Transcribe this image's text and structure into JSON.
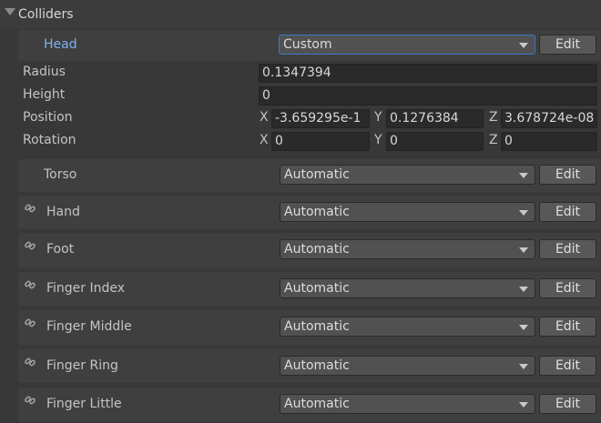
{
  "section": {
    "title": "Colliders"
  },
  "head": {
    "label": "Head",
    "dropdown": "Custom",
    "edit": "Edit",
    "radius_label": "Radius",
    "radius_value": "0.1347394",
    "height_label": "Height",
    "height_value": "0",
    "position_label": "Position",
    "position": {
      "x_label": "X",
      "x": "-3.659295e-1",
      "y_label": "Y",
      "y": "0.1276384",
      "z_label": "Z",
      "z": "3.678724e-08"
    },
    "rotation_label": "Rotation",
    "rotation": {
      "x_label": "X",
      "x": "0",
      "y_label": "Y",
      "y": "0",
      "z_label": "Z",
      "z": "0"
    }
  },
  "rows": [
    {
      "label": "Torso",
      "dropdown": "Automatic",
      "edit": "Edit",
      "linked": false
    },
    {
      "label": "Hand",
      "dropdown": "Automatic",
      "edit": "Edit",
      "linked": true
    },
    {
      "label": "Foot",
      "dropdown": "Automatic",
      "edit": "Edit",
      "linked": true
    },
    {
      "label": "Finger Index",
      "dropdown": "Automatic",
      "edit": "Edit",
      "linked": true
    },
    {
      "label": "Finger Middle",
      "dropdown": "Automatic",
      "edit": "Edit",
      "linked": true
    },
    {
      "label": "Finger Ring",
      "dropdown": "Automatic",
      "edit": "Edit",
      "linked": true
    },
    {
      "label": "Finger Little",
      "dropdown": "Automatic",
      "edit": "Edit",
      "linked": true
    }
  ],
  "icons": {
    "foldout": "triangle-down-icon",
    "link": "link-icon",
    "dropdown": "chevron-down-icon"
  }
}
